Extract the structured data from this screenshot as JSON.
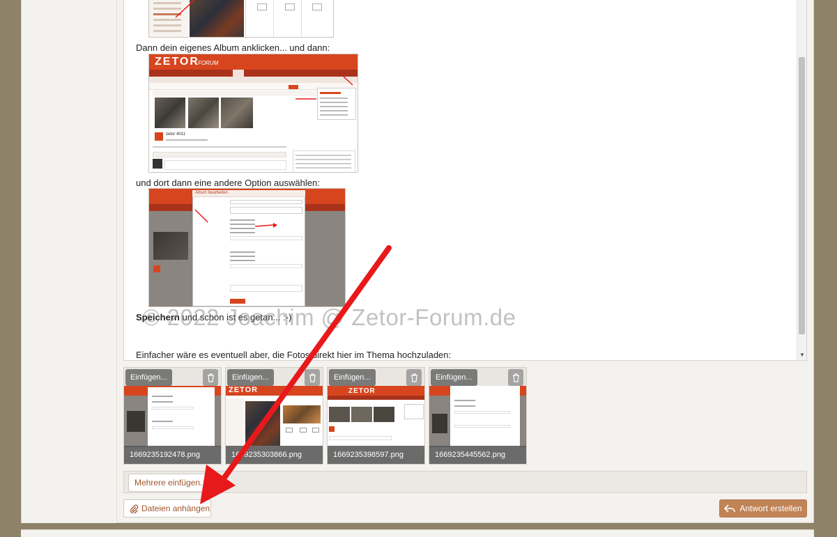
{
  "editor": {
    "line1": "Dann dein eigenes Album anklicken... und dann:",
    "line2": "und dort dann eine andere Option auswählen:",
    "line3_bold": "Speichern",
    "line3_rest": " und schon ist es getan... :-)",
    "line4": "Einfacher wäre es eventuell aber, die Fotos direkt hier im Thema hochzuladen:",
    "screenshot_brand": "ZETOR",
    "screenshot_brand_sub": "FORUM",
    "screenshot_user": "zetor 4011",
    "dialog_title": "Album bearbeiten"
  },
  "watermark": "© 2022 Joachim @ Zetor-Forum.de",
  "attachments": [
    {
      "filename": "1669235192478.png",
      "insert_label": "Einfügen..."
    },
    {
      "filename": "1669235303866.png",
      "insert_label": "Einfügen..."
    },
    {
      "filename": "1669235398597.png",
      "insert_label": "Einfügen..."
    },
    {
      "filename": "1669235445562.png",
      "insert_label": "Einfügen..."
    }
  ],
  "buttons": {
    "more_insert": "Mehrere einfügen...",
    "attach_files": "Dateien anhängen",
    "reply": "Antwort erstellen"
  },
  "colors": {
    "accent": "#a2542a",
    "reply_bg": "#c18457",
    "arrow": "#e8191a"
  },
  "icons": {
    "attach": "paperclip-icon",
    "reply": "reply-icon",
    "trash": "trash-icon"
  }
}
